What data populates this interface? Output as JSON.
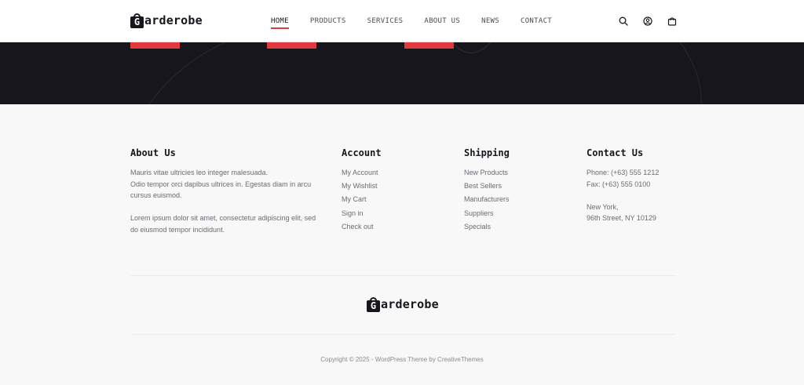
{
  "header": {
    "logo_letter": "G",
    "logo_text": "arderobe",
    "nav": [
      "HOME",
      "PRODUCTS",
      "SERVICES",
      "ABOUT US",
      "NEWS",
      "CONTACT"
    ],
    "active_nav": "HOME",
    "icons": [
      "search-icon",
      "user-icon",
      "cart-icon"
    ]
  },
  "colors": {
    "accent": "#e0393e",
    "dark_band": "#17161c",
    "footer_bg": "#f8f8f8"
  },
  "footer": {
    "about": {
      "title": "About Us",
      "p1_line1": "Mauris vitae ultricies leo integer malesuada.",
      "p1_line2": "Odio tempor orci dapibus ultrices in. Egestas diam in arcu",
      "p1_line3": "cursus euismod.",
      "p2_line1": "Lorem ipsum dolor sit amet, consectetur adipiscing elit, sed",
      "p2_line2": "do eiusmod tempor incididunt."
    },
    "account": {
      "title": "Account",
      "links": [
        "My Account",
        "My Wishlist",
        "My Cart",
        "Sign in",
        "Check out"
      ]
    },
    "shipping": {
      "title": "Shipping",
      "links": [
        "New Products",
        "Best Sellers",
        "Manufacturers",
        "Suppliers",
        "Specials"
      ]
    },
    "contact": {
      "title": "Contact Us",
      "phone": "Phone: (+63) 555 1212",
      "fax": "Fax: (+63) 555 0100",
      "city": "New York,",
      "street": "96th Street, NY 10129"
    },
    "copyright": "Copyright © 2025 - WordPress Theme by CreativeThemes"
  }
}
